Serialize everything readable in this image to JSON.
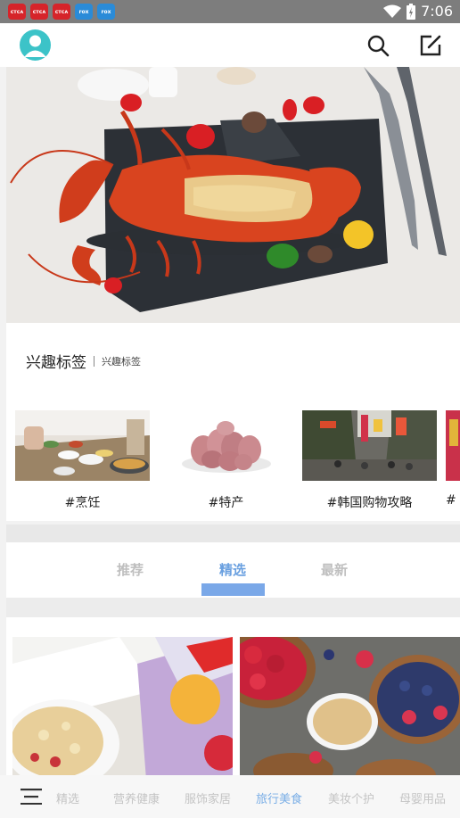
{
  "status_bar": {
    "apps": [
      {
        "name": "app-icon-1",
        "text": "ᴄᴛᴄᴀ",
        "color": "#d6242a"
      },
      {
        "name": "app-icon-2",
        "text": "ᴄᴛᴄᴀ",
        "color": "#d6242a"
      },
      {
        "name": "app-icon-3",
        "text": "ᴄᴛᴄᴀ",
        "color": "#d6242a"
      },
      {
        "name": "app-icon-4",
        "text": "rox",
        "color": "#2a8bd8"
      },
      {
        "name": "app-icon-5",
        "text": "rox",
        "color": "#2a8bd8"
      }
    ],
    "time": "7:06"
  },
  "header": {
    "icons": [
      "avatar",
      "search-icon",
      "edit-icon"
    ]
  },
  "interest": {
    "title": "兴趣标签",
    "subtitle": "兴趣标签"
  },
  "tags": [
    {
      "label": "#烹饪"
    },
    {
      "label": "#特产"
    },
    {
      "label": "#韩国购物攻略"
    },
    {
      "label": "#"
    }
  ],
  "tabs": [
    {
      "label": "推荐"
    },
    {
      "label": "精选"
    },
    {
      "label": "最新"
    }
  ],
  "active_tab": "精选",
  "bottom_nav": {
    "items": [
      "精选",
      "营养健康",
      "服饰家居",
      "旅行美食",
      "美妆个护",
      "母婴用品"
    ],
    "active": "旅行美食"
  },
  "colors": {
    "accent": "#6aa0e0",
    "tab_underline": "#7aa8e8",
    "avatar": "#3cc3c8"
  }
}
